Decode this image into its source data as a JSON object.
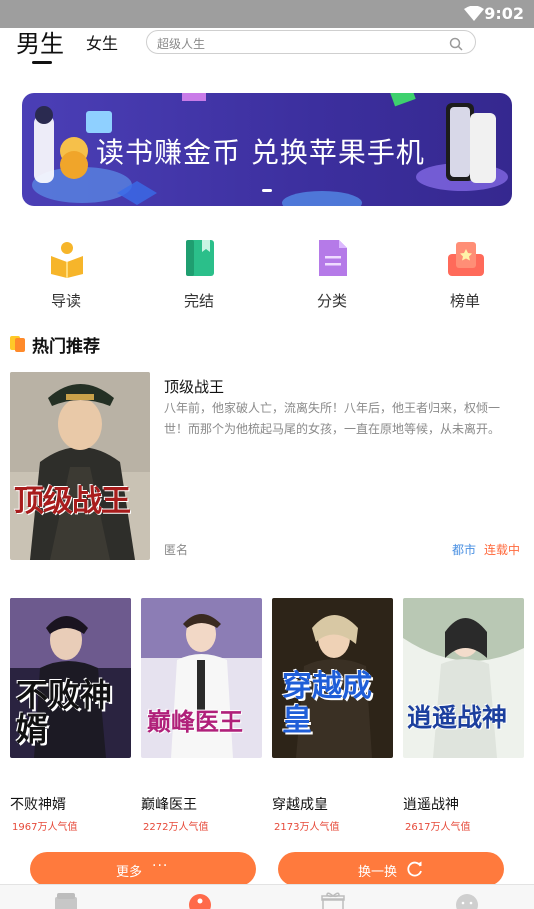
{
  "status_bar": {
    "time": "9:02",
    "wifi_icon": "wifi-icon"
  },
  "header": {
    "tabs": [
      {
        "label": "男生",
        "active": true
      },
      {
        "label": "女生",
        "active": false
      }
    ],
    "search": {
      "placeholder": "超级人生",
      "icon": "search-icon"
    }
  },
  "banner": {
    "text": "读书赚金币  兑换苹果手机"
  },
  "quick_nav": [
    {
      "label": "导读",
      "icon": "reading-guide-icon",
      "color": "#f6b52a"
    },
    {
      "label": "完结",
      "icon": "book-complete-icon",
      "color": "#2bbf8a"
    },
    {
      "label": "分类",
      "icon": "category-icon",
      "color": "#b57ae8"
    },
    {
      "label": "榜单",
      "icon": "ranking-icon",
      "color": "#ff6a5a"
    }
  ],
  "section": {
    "title": "热门推荐"
  },
  "featured": {
    "title": "顶级战王",
    "description": "八年前，他家破人亡，流离失所！八年后，他王者归来，权倾一世！而那个为他梳起马尾的女孩，一直在原地等候，从未离开。",
    "author": "匿名",
    "genre": "都市",
    "status": "连载中",
    "cover_text": "顶级战王"
  },
  "books": [
    {
      "title": "不败神婿",
      "popularity": "1967万人气值",
      "cover_text": "不败神婿"
    },
    {
      "title": "巅峰医王",
      "popularity": "2272万人气值",
      "cover_text": "巅峰医王"
    },
    {
      "title": "穿越成皇",
      "popularity": "2173万人气值",
      "cover_text": "穿越成皇"
    },
    {
      "title": "逍遥战神",
      "popularity": "2617万人气值",
      "cover_text": "逍遥战神"
    }
  ],
  "actions": {
    "more": "更多",
    "more_dots": "···",
    "refresh": "换一换"
  },
  "bottom_nav": [
    {
      "icon": "bookshelf-icon"
    },
    {
      "icon": "bookstore-icon",
      "active": true
    },
    {
      "icon": "gift-icon"
    },
    {
      "icon": "profile-icon"
    }
  ],
  "colors": {
    "accent": "#ff7a3d",
    "banner": "#4b3fb6",
    "link": "#4a90e2",
    "popularity": "#e64a3a"
  }
}
